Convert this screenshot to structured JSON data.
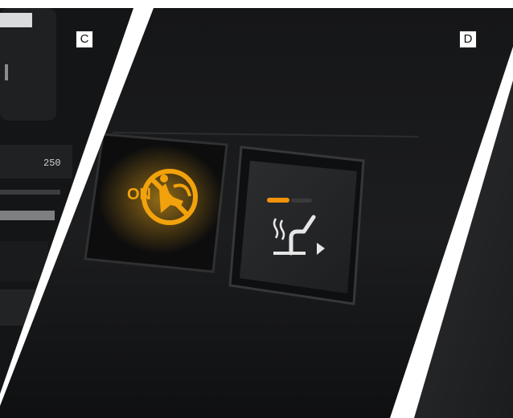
{
  "panels": {
    "left_label": "C",
    "right_label": "D"
  },
  "left_panel": {
    "display_readout": "250"
  },
  "airbag_indicator": {
    "text": "ON",
    "icon": "passenger-airbag-off-icon",
    "glow_color": "#f2a20c"
  },
  "seat_heat_button": {
    "icon": "seat-heater-icon",
    "arrow_icon": "triangle-right-icon",
    "level_color": "#f0920a"
  },
  "colors": {
    "background": "#ffffff",
    "console_dark": "#1a1b1d",
    "indicator_amber": "#f2a20c"
  }
}
